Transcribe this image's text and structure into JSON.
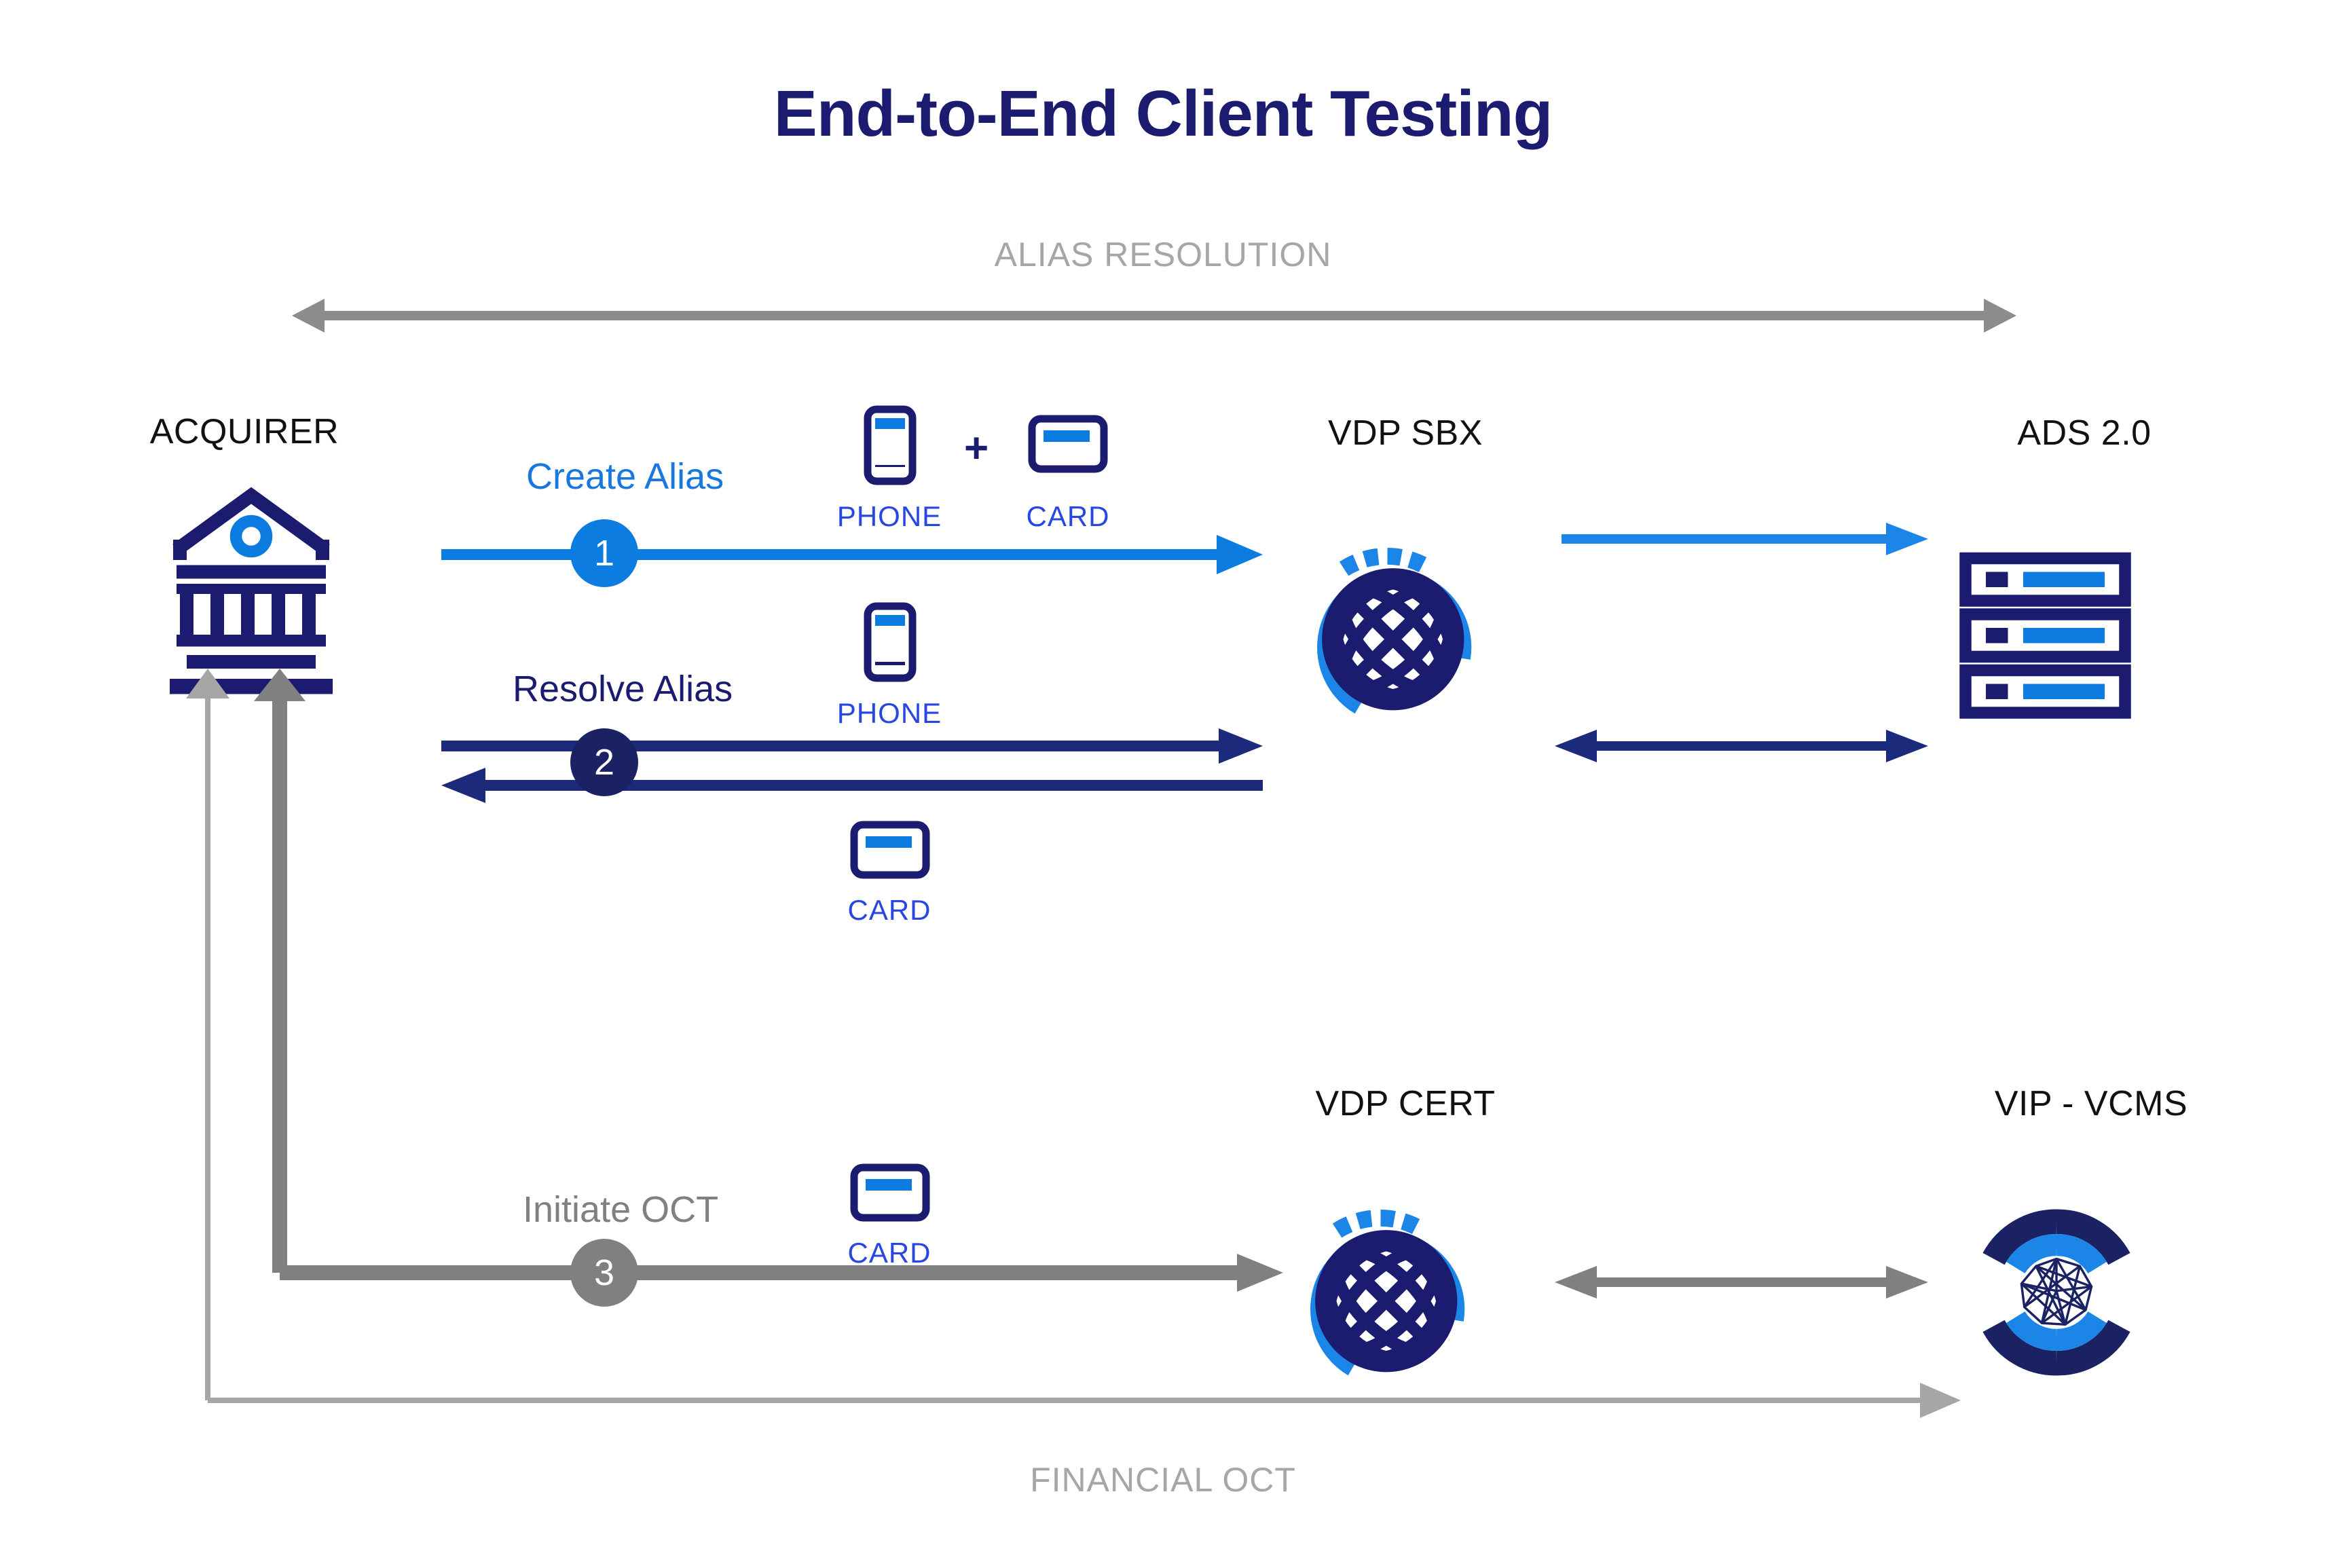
{
  "title": "End-to-End Client Testing",
  "bands": {
    "top": {
      "label": "ALIAS RESOLUTION"
    },
    "bottom": {
      "label": "FINANCIAL OCT"
    }
  },
  "nodes": {
    "acquirer": {
      "label": "ACQUIRER",
      "icon": "bank-icon"
    },
    "vdp_sbx": {
      "label": "VDP SBX",
      "icon": "globe-icon"
    },
    "ads": {
      "label": "ADS 2.0",
      "icon": "server-rack-icon"
    },
    "vdp_cert": {
      "label": "VDP CERT",
      "icon": "globe-icon"
    },
    "vip_vcms": {
      "label": "VIP - VCMS",
      "icon": "network-ring-icon"
    }
  },
  "steps": [
    {
      "number": "1",
      "label": "Create Alias",
      "color": "#0d7ce0"
    },
    {
      "number": "2",
      "label": "Resolve Alias",
      "color": "#1b2264"
    },
    {
      "number": "3",
      "label": "Initiate OCT",
      "color": "#808080"
    }
  ],
  "payload_icons": {
    "phone": "PHONE",
    "card": "CARD",
    "plus": "+"
  },
  "colors": {
    "navy": "#1b1b6f",
    "blue": "#0d7ce0",
    "blue_bright": "#1878e0",
    "gray": "#808080",
    "gray_light": "#a6a6a6",
    "caption_blue": "#2747e0",
    "title_navy": "#1b1b6f"
  }
}
